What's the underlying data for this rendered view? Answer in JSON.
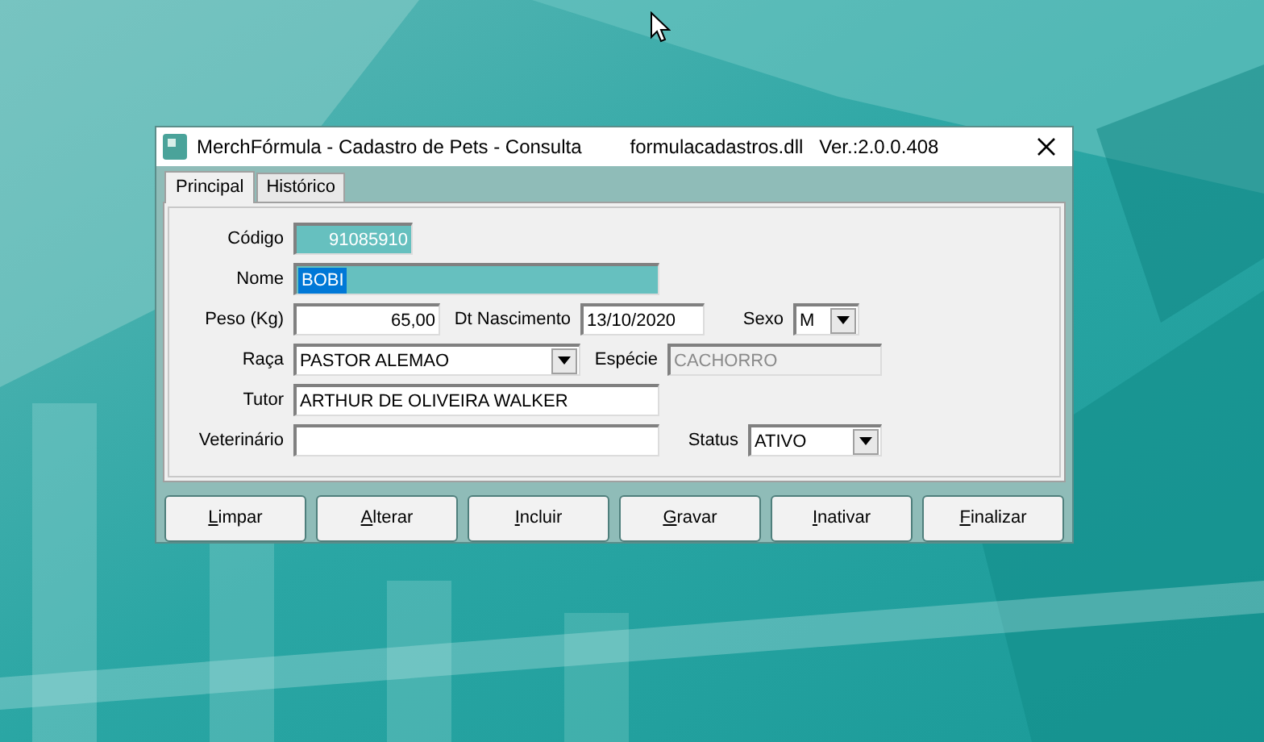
{
  "window": {
    "title": "MerchFórmula - Cadastro de Pets - Consulta",
    "module": "formulacadastros.dll   Ver.:2.0.0.408"
  },
  "tabs": [
    {
      "label": "Principal",
      "selected": true
    },
    {
      "label": "Histórico",
      "selected": false
    }
  ],
  "form_rows": [
    [
      {
        "label": "Código",
        "value": "91085910",
        "kind": "readonly"
      }
    ],
    [
      {
        "label": "Nome",
        "value": "BOBI",
        "kind": "text",
        "text_selected": true
      }
    ],
    [
      {
        "label": "Peso (Kg)",
        "value": "65,00",
        "kind": "number"
      },
      {
        "label": "Dt Nascimento",
        "value": "13/10/2020",
        "kind": "text"
      },
      {
        "label": "Sexo",
        "value": "M",
        "kind": "dropdown"
      }
    ],
    [
      {
        "label": "Raça",
        "value": "PASTOR ALEMAO",
        "kind": "dropdown"
      },
      {
        "label": "Espécie",
        "value": "CACHORRO",
        "kind": "disabled"
      }
    ],
    [
      {
        "label": "Tutor",
        "value": "ARTHUR DE OLIVEIRA WALKER",
        "kind": "text"
      }
    ],
    [
      {
        "label": "Veterinário",
        "kind": "text"
      },
      {
        "label": "Status",
        "value": "ATIVO",
        "kind": "dropdown"
      }
    ]
  ],
  "buttons": [
    "Limpar",
    "Alterar",
    "Incluir",
    "Gravar",
    "Inativar",
    "Finalizar"
  ]
}
